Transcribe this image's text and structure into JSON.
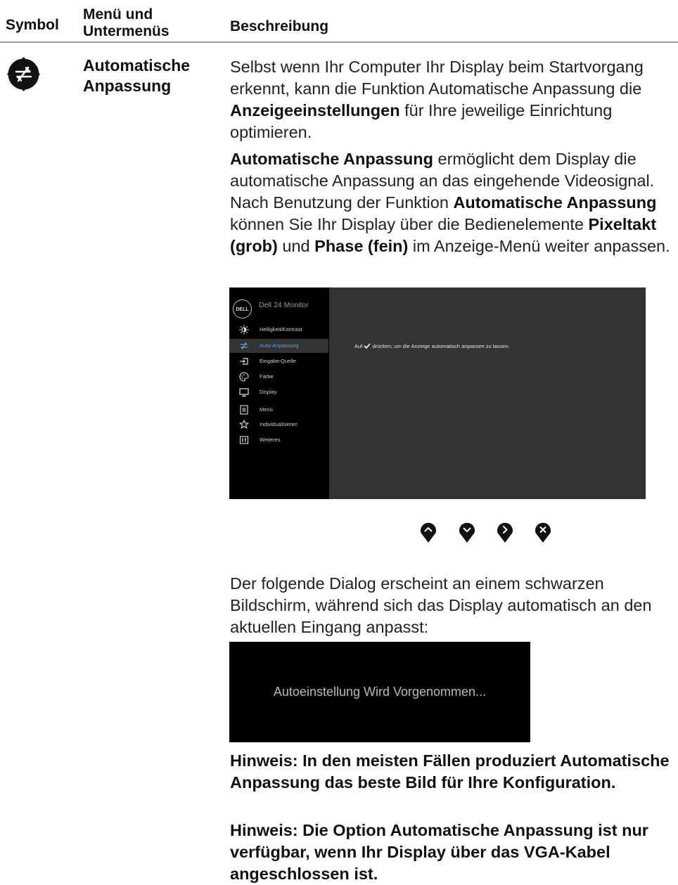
{
  "header": {
    "col_symbol": "Symbol",
    "col_menu_line1": "Menü und",
    "col_menu_line2": "Untermenüs",
    "col_desc": "Beschreibung"
  },
  "row": {
    "icon": "auto-adjust-icon",
    "menu_line1": "Automatische",
    "menu_line2": "Anpassung"
  },
  "p1": {
    "a": "Selbst wenn Ihr Computer Ihr Display beim Startvorgang erkennt, kann die Funktion Automatische Anpassung die ",
    "b": "Anzeigeeinstellungen",
    "c": " für Ihre jeweilige Einrichtung optimieren."
  },
  "p2": {
    "a": "Automatische Anpassung",
    "b": " ermöglicht dem Display die automatische Anpassung an das eingehende Videosignal. Nach Benutzung der Funktion ",
    "c": "Automatische Anpassung",
    "d": " können Sie Ihr Display über die Bedienelemente ",
    "e": "Pixeltakt (grob)",
    "f": " und ",
    "g": "Phase (fein)",
    "h": " im Anzeige-Menü weiter anpassen."
  },
  "osd": {
    "logo": "DELL",
    "title": "Dell 24 Monitor",
    "items": [
      {
        "label": "Helligkeit/Kontrast",
        "icon": "brightness-icon"
      },
      {
        "label": "Auto-Anpassung",
        "icon": "auto-adjust-icon"
      },
      {
        "label": "Eingabe-Quelle",
        "icon": "input-source-icon"
      },
      {
        "label": "Farbe",
        "icon": "color-palette-icon"
      },
      {
        "label": "Display",
        "icon": "display-icon"
      },
      {
        "label": "Menü",
        "icon": "menu-icon"
      },
      {
        "label": "Individualisieren",
        "icon": "star-icon"
      },
      {
        "label": "Weiteres",
        "icon": "others-icon"
      }
    ],
    "selected_index": 1,
    "message_pre": "Auf",
    "message_post": "drücken, um die Anzeige automatisch anpassen zu lassen."
  },
  "buttons": [
    "up-button",
    "down-button",
    "right-button",
    "close-button"
  ],
  "p3": "Der folgende Dialog erscheint an einem schwarzen Bildschirm, während sich das Display automatisch an den aktuellen Eingang anpasst:",
  "dialog": {
    "text": "Autoeinstellung Wird Vorgenommen..."
  },
  "note1": "Hinweis: In den meisten Fällen produziert Automatische Anpassung das beste Bild für Ihre Konfiguration.",
  "note2": "Hinweis: Die Option Automatische Anpassung ist nur verfügbar, wenn Ihr Display über das VGA-Kabel angeschlossen ist.",
  "colors": {
    "osd_bg": "#333333",
    "osd_sidebar": "#000000",
    "osd_selected": "#5aa6e6",
    "dialog_bg": "#000000"
  }
}
